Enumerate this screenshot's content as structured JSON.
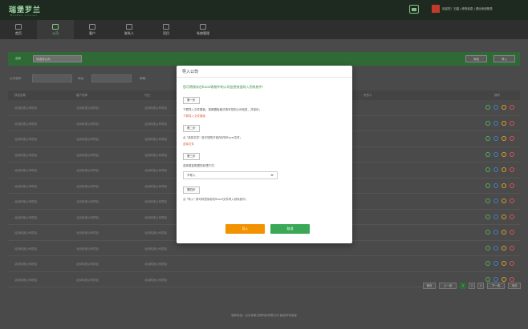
{
  "header": {
    "logo_text": "瑞堡罗兰",
    "logo_subtext": "Ruibao  Luolan",
    "user_text": "欢迎您！王磨  |  修改信息  |  退出系统登录"
  },
  "nav": {
    "items": [
      {
        "label": "首页",
        "icon": "home-icon"
      },
      {
        "label": "公司",
        "icon": "folder-icon"
      },
      {
        "label": "客户",
        "icon": "user-icon"
      },
      {
        "label": "联系人",
        "icon": "contacts-icon"
      },
      {
        "label": "项目",
        "icon": "project-icon"
      },
      {
        "label": "系统管理",
        "icon": "settings-icon"
      }
    ],
    "active_index": 1
  },
  "filter": {
    "label": "选择",
    "select_value": "请选择公司",
    "btn_add": "添加",
    "btn_import": "导入"
  },
  "search": {
    "field1": "公司名称：",
    "field2": "地址：",
    "field3": "邮箱："
  },
  "table": {
    "headers": [
      "项目名称",
      "客户名称",
      "行业",
      "",
      "",
      "负责人",
      "操作"
    ],
    "rows": [
      {
        "c1": "北京科技公司项目",
        "c2": "北京科技公司项目",
        "c3": "北京科技公司项目"
      },
      {
        "c1": "北京科技公司项目",
        "c2": "北京科技公司项目",
        "c3": "北京科技公司项目"
      },
      {
        "c1": "北京科技公司项目",
        "c2": "北京科技公司项目",
        "c3": "北京科技公司项目"
      },
      {
        "c1": "北京科技公司项目",
        "c2": "北京科技公司项目",
        "c3": "北京科技公司项目"
      },
      {
        "c1": "北京科技公司项目",
        "c2": "北京科技公司项目",
        "c3": "北京科技公司项目"
      },
      {
        "c1": "北京科技公司项目",
        "c2": "北京科技公司项目",
        "c3": "北京科技公司项目"
      },
      {
        "c1": "北京科技公司项目",
        "c2": "北京科技公司项目",
        "c3": "北京科技公司项目"
      },
      {
        "c1": "北京科技公司项目",
        "c2": "北京科技公司项目",
        "c3": "北京科技公司项目"
      },
      {
        "c1": "北京科技公司项目",
        "c2": "北京科技公司项目",
        "c3": "北京科技公司项目"
      },
      {
        "c1": "北京科技公司项目",
        "c2": "北京科技公司项目",
        "c3": "北京科技公司项目"
      },
      {
        "c1": "北京科技公司项目",
        "c2": "北京科技公司项目",
        "c3": "北京科技公司项目"
      },
      {
        "c1": "北京科技公司项目",
        "c2": "北京科技公司项目",
        "c3": "北京科技公司项目"
      }
    ]
  },
  "pager": {
    "first": "首页",
    "prev": "上一页",
    "p1": "1",
    "p2": "2",
    "p3": "3",
    "next": "下一页",
    "last": "末页"
  },
  "footer": {
    "text": "服务电话：北京某某互联科技有限公司  版权所有保留"
  },
  "modal": {
    "title": "导入公司",
    "intro": "您可将保存在Excel表格中的公司信息快速导入到系统中：",
    "step1": "第一步",
    "step1_desc": "下载导入文件模板，按照模板格式填写您的公司信息，并保存；",
    "step1_link": "下载导入文件模板",
    "step2": "第二步",
    "step2_desc": "点 \"选择文件\" 选中您刚才保存好的Excel文件；",
    "step2_link": "选择文件",
    "step3": "第三步",
    "step3_desc": "选择重复数据的处理方式：",
    "step3_select": "不导入",
    "step4": "第四步",
    "step4_desc": "点 \"导入\" 即可将您保存的Excel文件导入到系统中。",
    "btn_import": "导入",
    "btn_cancel": "取消"
  },
  "colors": {
    "brand_green": "#2f8a3c",
    "import_orange": "#f29200",
    "cancel_green": "#3aa856"
  }
}
